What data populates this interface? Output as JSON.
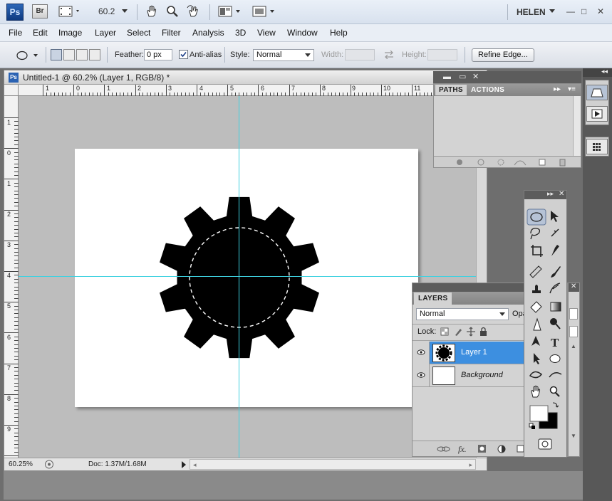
{
  "app": {
    "logo": "Ps",
    "bridge": "Br",
    "zoom": "60.2",
    "user": "HELEN",
    "window_controls": [
      "—",
      "□",
      "✕"
    ]
  },
  "menu": [
    "File",
    "Edit",
    "Image",
    "Layer",
    "Select",
    "Filter",
    "Analysis",
    "3D",
    "View",
    "Window",
    "Help"
  ],
  "options": {
    "feather_label": "Feather:",
    "feather_value": "0 px",
    "antialias_label": "Anti-alias",
    "antialias_checked": true,
    "style_label": "Style:",
    "style_value": "Normal",
    "width_label": "Width:",
    "height_label": "Height:",
    "refine_edge": "Refine Edge..."
  },
  "document": {
    "title": "Untitled-1 @ 60.2% (Layer 1, RGB/8) *",
    "ruler_h": [
      "1",
      "0",
      "1",
      "2",
      "3",
      "4",
      "5",
      "6",
      "7",
      "8",
      "9",
      "10",
      "11"
    ],
    "ruler_v": [
      "1",
      "0",
      "1",
      "2",
      "3",
      "4",
      "5",
      "6",
      "7",
      "8",
      "9"
    ],
    "status_zoom": "60.25%",
    "status_doc": "Doc: 1.37M/1.68M"
  },
  "paths_panel": {
    "tabs": [
      "PATHS",
      "ACTIONS"
    ]
  },
  "layers_panel": {
    "tab": "LAYERS",
    "blend_mode": "Normal",
    "opacity_label": "Opa",
    "lock_label": "Lock:",
    "layers": [
      {
        "name": "Layer 1",
        "selected": true,
        "italic": false
      },
      {
        "name": "Background",
        "selected": false,
        "italic": true
      }
    ]
  },
  "colors": {
    "selection": "#3d8fe0",
    "guide": "#3fd1e0",
    "foreground": "#000000",
    "background": "#ffffff"
  }
}
